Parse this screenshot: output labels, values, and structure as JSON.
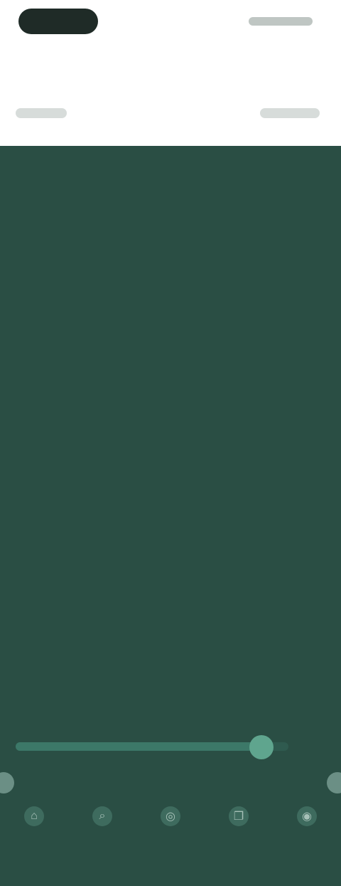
{
  "status_bar": {
    "left_label": "",
    "right_label": ""
  },
  "header": {
    "title": "",
    "subtitle": "",
    "left_nav_label": "",
    "right_nav_label": ""
  },
  "menu": {
    "group1": [
      {
        "label": ""
      },
      {
        "label": ""
      },
      {
        "label": ""
      },
      {
        "label": ""
      },
      {
        "label": ""
      }
    ],
    "group2": [
      {
        "label": ""
      },
      {
        "label": ""
      },
      {
        "label": ""
      },
      {
        "label": ""
      },
      {
        "label": ""
      }
    ],
    "right_links": [
      {
        "label": ""
      },
      {
        "label": ""
      }
    ]
  },
  "progress": {
    "value_fraction": 0.9
  },
  "pager": {
    "label": ""
  },
  "bottom_nav": [
    {
      "label": "",
      "icon": "home-icon"
    },
    {
      "label": "",
      "icon": "search-icon"
    },
    {
      "label": "",
      "icon": "center-icon"
    },
    {
      "label": "",
      "icon": "bookmark-icon"
    },
    {
      "label": "",
      "icon": "profile-icon"
    }
  ],
  "colors": {
    "primary": "#2a4e44",
    "header_bg": "#ffffff",
    "accent": "#5fa58e"
  }
}
